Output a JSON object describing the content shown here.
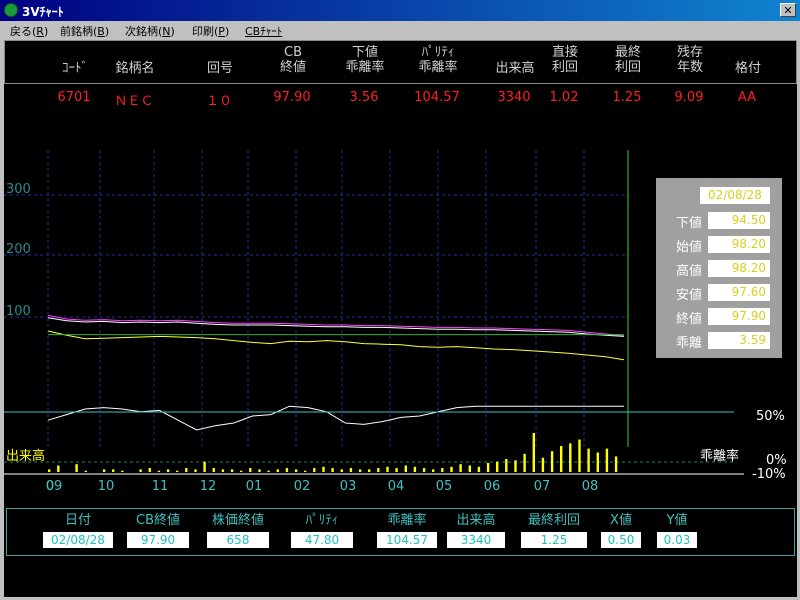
{
  "window": {
    "title": "3Vﾁｬｰﾄ",
    "close_glyph": "✕"
  },
  "menu": [
    {
      "label": "戻る(",
      "key": "R",
      "tail": ")"
    },
    {
      "label": "前銘柄(",
      "key": "B",
      "tail": ")"
    },
    {
      "label": "次銘柄(",
      "key": "N",
      "tail": ")"
    },
    {
      "label": "印刷(",
      "key": "P",
      "tail": ")"
    },
    {
      "label": "",
      "key": "CBﾁｬｰﾄ",
      "tail": ""
    }
  ],
  "header": {
    "columns": [
      {
        "line1": "",
        "line2": "ｺｰﾄﾞ"
      },
      {
        "line1": "",
        "line2": "銘柄名"
      },
      {
        "line1": "",
        "line2": "回号"
      },
      {
        "line1": "CB",
        "line2": "終値"
      },
      {
        "line1": "下値",
        "line2": "乖離率"
      },
      {
        "line1": "ﾊﾟﾘﾃｨ",
        "line2": "乖離率"
      },
      {
        "line1": "",
        "line2": "出来高"
      },
      {
        "line1": "直接",
        "line2": "利回"
      },
      {
        "line1": "最終",
        "line2": "利回"
      },
      {
        "line1": "残存",
        "line2": "年数"
      },
      {
        "line1": "",
        "line2": "格付"
      }
    ],
    "values": [
      "6701",
      "ＮＥＣ",
      "１０",
      "97.90",
      "3.56",
      "104.57",
      "3340",
      "1.02",
      "1.25",
      "9.09",
      "AA"
    ]
  },
  "info_box": {
    "date": "02/08/28",
    "rows": [
      {
        "label": "下値",
        "value": "94.50"
      },
      {
        "label": "始値",
        "value": "98.20"
      },
      {
        "label": "高値",
        "value": "98.20"
      },
      {
        "label": "安値",
        "value": "97.60"
      },
      {
        "label": "終値",
        "value": "97.90"
      },
      {
        "label": "乖離",
        "value": "3.59"
      }
    ]
  },
  "bottom": [
    {
      "label": "日付",
      "value": "02/08/28"
    },
    {
      "label": "CB終値",
      "value": "97.90"
    },
    {
      "label": "株価終値",
      "value": "658"
    },
    {
      "label": "ﾊﾟﾘﾃｨ",
      "value": "47.80"
    },
    {
      "label": "乖離率",
      "value": "104.57"
    },
    {
      "label": "出来高",
      "value": "3340"
    },
    {
      "label": "最終利回",
      "value": "1.25"
    },
    {
      "label": "X値",
      "value": "0.50"
    },
    {
      "label": "Y値",
      "value": "0.03"
    }
  ],
  "chart_data": {
    "type": "line",
    "y_tick_labels": [
      "300",
      "200",
      "100"
    ],
    "x_tick_labels": [
      "09",
      "10",
      "11",
      "12",
      "01",
      "02",
      "03",
      "04",
      "05",
      "06",
      "07",
      "08"
    ],
    "x_overlap_label": "0",
    "volume_label": "出来高",
    "divergence_label": "乖離率",
    "right_ticks": [
      "50%",
      "0%",
      "-10%"
    ],
    "series": [
      {
        "color": "#ff40ff",
        "values": [
          136,
          130,
          128,
          129,
          127,
          128,
          127,
          128,
          126,
          124,
          123,
          123,
          123,
          122,
          121,
          120,
          120,
          119,
          119,
          118,
          117,
          116,
          116,
          115,
          115,
          114,
          113,
          112,
          111,
          108,
          105,
          103
        ]
      },
      {
        "color": "#ffffff",
        "values": [
          132,
          127,
          125,
          126,
          124,
          125,
          124,
          125,
          123,
          121,
          120,
          120,
          120,
          119,
          118,
          117,
          117,
          116,
          116,
          115,
          114,
          113,
          113,
          112,
          112,
          111,
          110,
          109,
          108,
          105,
          103,
          101
        ]
      },
      {
        "color": "#ffff40",
        "values": [
          110,
          103,
          97,
          98,
          99,
          100,
          101,
          100,
          99,
          97,
          94,
          91,
          89,
          93,
          92,
          94,
          92,
          89,
          88,
          87,
          84,
          83,
          84,
          82,
          80,
          79,
          77,
          75,
          73,
          70,
          67,
          62
        ]
      },
      {
        "color": "#30b030",
        "values": [
          104,
          104,
          104,
          104,
          104,
          104,
          104,
          104,
          104,
          104,
          104,
          104,
          104,
          104,
          104,
          104,
          104,
          104,
          104,
          104,
          104,
          104,
          104,
          104,
          104,
          104,
          104,
          104,
          104,
          104,
          104,
          104
        ]
      },
      {
        "color": "#ffffff",
        "values": [
          12,
          16,
          20,
          21,
          20,
          18,
          19,
          12,
          5,
          8,
          10,
          15,
          16,
          22,
          21,
          18,
          10,
          9,
          11,
          14,
          15,
          18,
          21,
          22,
          22,
          22,
          22,
          22,
          22,
          22,
          22,
          22
        ]
      }
    ],
    "volume": [
      2,
      5,
      0,
      6,
      1,
      0,
      2,
      2,
      1,
      0,
      2,
      3,
      1,
      2,
      1,
      3,
      2,
      8,
      3,
      2,
      2,
      1,
      3,
      2,
      1,
      2,
      3,
      2,
      1,
      3,
      4,
      3,
      2,
      3,
      2,
      2,
      3,
      4,
      3,
      5,
      4,
      3,
      2,
      3,
      4,
      6,
      5,
      4,
      7,
      8,
      10,
      9,
      14,
      30,
      11,
      16,
      20,
      22,
      25,
      18,
      15,
      18,
      12
    ]
  }
}
